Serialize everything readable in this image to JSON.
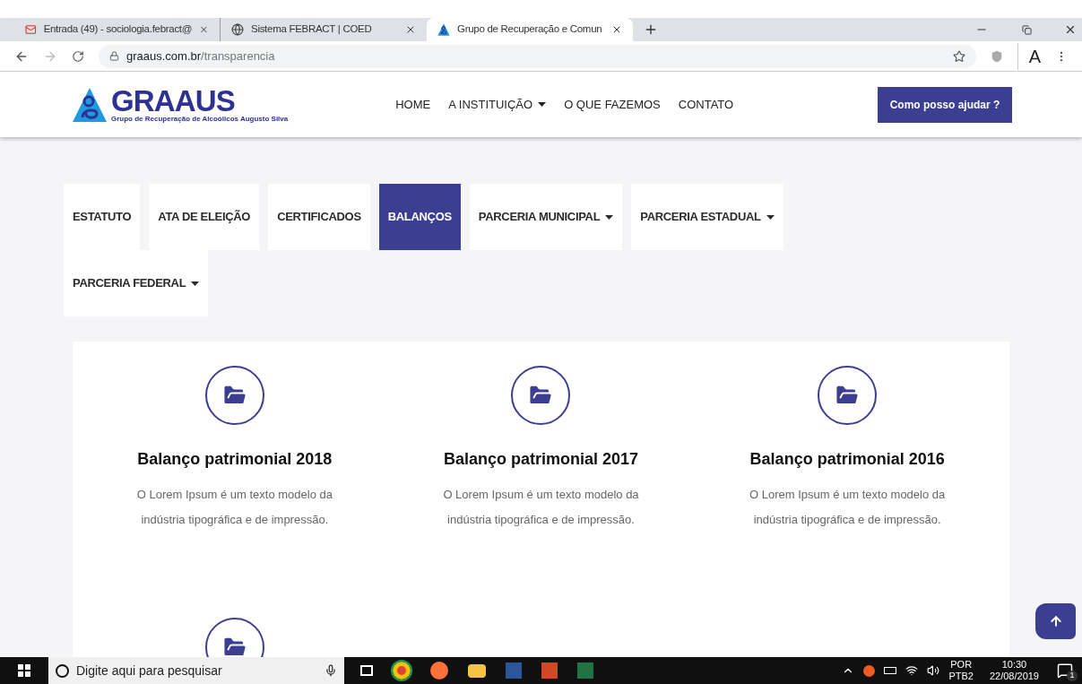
{
  "browser": {
    "tabs": [
      {
        "title": "Entrada (49) - sociologia.febract@",
        "kind": "mail",
        "selected": false
      },
      {
        "title": "Sistema FEBRACT | COED",
        "kind": "globe",
        "selected": false
      },
      {
        "title": "Grupo de Recuperação e Comun",
        "kind": "logo",
        "selected": true
      }
    ],
    "url_host": "graaus.com.br",
    "url_path": "/transparencia",
    "profile_letter": "A"
  },
  "site": {
    "logo_text": "GRAAUS",
    "logo_subtitle": "Grupo de Recuperação de Alcoólicos Augusto Silva",
    "nav": [
      {
        "label": "HOME",
        "dropdown": false
      },
      {
        "label": "A INSTITUIÇÃO",
        "dropdown": true
      },
      {
        "label": "O QUE FAZEMOS",
        "dropdown": false
      },
      {
        "label": "CONTATO",
        "dropdown": false
      }
    ],
    "cta": "Como posso ajudar ?"
  },
  "tabs": [
    {
      "label": "ESTATUTO",
      "dropdown": false,
      "selected": false
    },
    {
      "label": "ATA DE ELEIÇÃO",
      "dropdown": false,
      "selected": false
    },
    {
      "label": "CERTIFICADOS",
      "dropdown": false,
      "selected": false
    },
    {
      "label": "BALANÇOS",
      "dropdown": false,
      "selected": true
    },
    {
      "label": "PARCERIA MUNICIPAL",
      "dropdown": true,
      "selected": false
    },
    {
      "label": "PARCERIA ESTADUAL",
      "dropdown": true,
      "selected": false
    },
    {
      "label": "PARCERIA FEDERAL",
      "dropdown": true,
      "selected": false
    }
  ],
  "items": [
    {
      "title": "Balanço patrimonial 2018",
      "description": "O Lorem Ipsum é um texto modelo da indústria tipográfica e de impressão."
    },
    {
      "title": "Balanço patrimonial 2017",
      "description": "O Lorem Ipsum é um texto modelo da indústria tipográfica e de impressão."
    },
    {
      "title": "Balanço patrimonial 2016",
      "description": "O Lorem Ipsum é um texto modelo da indústria tipográfica e de impressão."
    }
  ],
  "next_row_icon": true,
  "taskbar": {
    "search_placeholder": "Digite aqui para pesquisar",
    "lang_top": "POR",
    "lang_bottom": "PTB2",
    "time": "10:30",
    "date": "22/08/2019",
    "notifications": "1"
  }
}
